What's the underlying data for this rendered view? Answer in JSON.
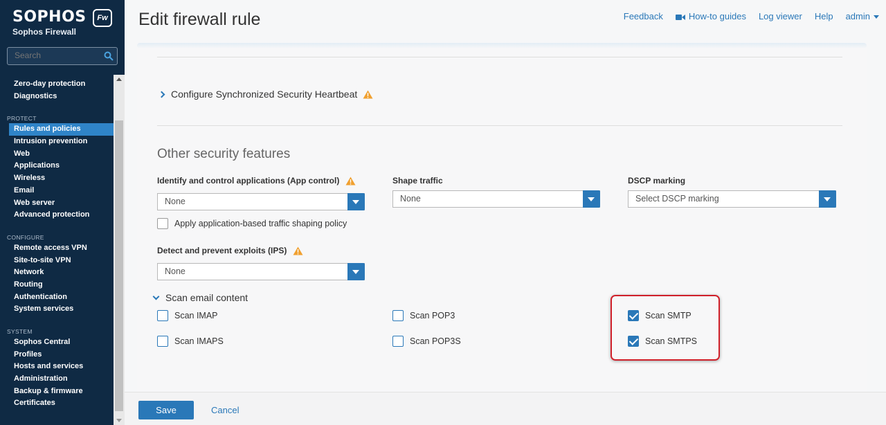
{
  "brand": {
    "name": "SOPHOS",
    "badge": "Fw",
    "product": "Sophos Firewall"
  },
  "search": {
    "placeholder": "Search"
  },
  "nav": {
    "partial_item": "",
    "monitor_items": [
      "Zero-day protection",
      "Diagnostics"
    ],
    "sections": [
      {
        "title": "PROTECT",
        "items": [
          "Rules and policies",
          "Intrusion prevention",
          "Web",
          "Applications",
          "Wireless",
          "Email",
          "Web server",
          "Advanced protection"
        ]
      },
      {
        "title": "CONFIGURE",
        "items": [
          "Remote access VPN",
          "Site-to-site VPN",
          "Network",
          "Routing",
          "Authentication",
          "System services"
        ]
      },
      {
        "title": "SYSTEM",
        "items": [
          "Sophos Central",
          "Profiles",
          "Hosts and services",
          "Administration",
          "Backup & firmware",
          "Certificates"
        ]
      }
    ],
    "active_item": "Rules and policies"
  },
  "header": {
    "title": "Edit firewall rule",
    "links": {
      "feedback": "Feedback",
      "howto": "How-to guides",
      "logviewer": "Log viewer",
      "help": "Help",
      "user": "admin"
    }
  },
  "heartbeat": {
    "label": "Configure Synchronized Security Heartbeat"
  },
  "other_security": {
    "title": "Other security features",
    "app_control": {
      "label": "Identify and control applications (App control)",
      "value": "None"
    },
    "shaping_policy": {
      "label": "Apply application-based traffic shaping policy",
      "checked": false
    },
    "shape_traffic": {
      "label": "Shape traffic",
      "value": "None"
    },
    "dscp": {
      "label": "DSCP marking",
      "value": "Select DSCP marking"
    },
    "ips": {
      "label": "Detect and prevent exploits (IPS)",
      "value": "None"
    }
  },
  "scan_email": {
    "title": "Scan email content",
    "imap": {
      "label": "Scan IMAP",
      "checked": false
    },
    "imaps": {
      "label": "Scan IMAPS",
      "checked": false
    },
    "pop3": {
      "label": "Scan POP3",
      "checked": false
    },
    "pop3s": {
      "label": "Scan POP3S",
      "checked": false
    },
    "smtp": {
      "label": "Scan SMTP",
      "checked": true
    },
    "smtps": {
      "label": "Scan SMTPS",
      "checked": true
    }
  },
  "footer": {
    "save": "Save",
    "cancel": "Cancel"
  },
  "colors": {
    "accent": "#2a78b8",
    "sidebar": "#0f2a44",
    "highlight": "#d0202a",
    "warning": "#f0a030"
  }
}
